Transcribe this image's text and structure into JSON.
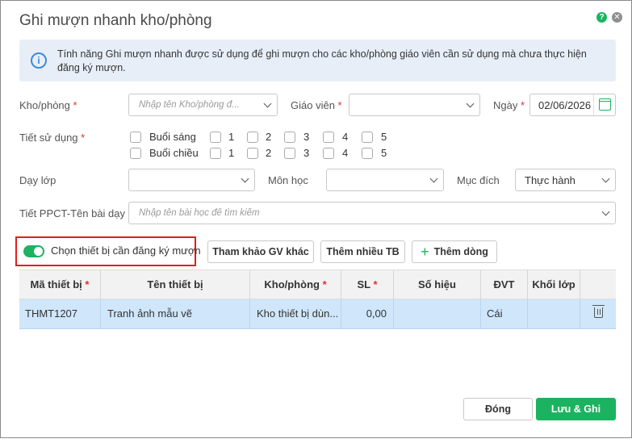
{
  "dialog": {
    "title": "Ghi mượn nhanh kho/phòng",
    "help_icon": "?",
    "close_icon": "✕"
  },
  "info": {
    "icon": "i",
    "text": "Tính năng Ghi mượn nhanh được sử dụng để ghi mượn cho các kho/phòng giáo viên cần sử dụng mà chưa thực hiện đăng ký mượn."
  },
  "form": {
    "kho_phong": {
      "label": "Kho/phòng",
      "placeholder": "Nhập tên Kho/phòng đ..."
    },
    "giao_vien": {
      "label": "Giáo viên",
      "value": ""
    },
    "ngay": {
      "label": "Ngày",
      "value": "02/06/2026"
    },
    "tiet_su_dung": {
      "label": "Tiết sử dụng",
      "sessions": [
        {
          "name": "Buổi sáng",
          "periods": [
            "1",
            "2",
            "3",
            "4",
            "5"
          ]
        },
        {
          "name": "Buổi chiều",
          "periods": [
            "1",
            "2",
            "3",
            "4",
            "5"
          ]
        }
      ]
    },
    "day_lop": {
      "label": "Dạy lớp",
      "value": ""
    },
    "mon_hoc": {
      "label": "Môn học",
      "value": ""
    },
    "muc_dich": {
      "label": "Mục đích",
      "value": "Thực hành"
    },
    "tiet_ppct": {
      "label": "Tiết PPCT-Tên bài dạy",
      "placeholder": "Nhập tên bài học để tìm kiếm"
    },
    "required_mark": "*"
  },
  "toolbar": {
    "toggle_label": "Chọn thiết bị cần đăng ký mượn",
    "toggle_on": true,
    "btn_tham_khao": "Tham khảo GV khác",
    "btn_them_nhieu": "Thêm nhiều TB",
    "btn_them_dong": "Thêm dòng",
    "plus": "+"
  },
  "table": {
    "headers": [
      "Mã thiết bị",
      "Tên thiết bị",
      "Kho/phòng",
      "SL",
      "Số hiệu",
      "ĐVT",
      "Khối lớp"
    ],
    "rows": [
      {
        "ma": "THMT1207",
        "ten": "Tranh ảnh mẫu vẽ",
        "kho": "Kho thiết bị dùn...",
        "sl": "0,00",
        "so_hieu": "",
        "dvt": "Cái",
        "khoi_lop": ""
      }
    ]
  },
  "footer": {
    "close_label": "Đóng",
    "save_label": "Lưu & Ghi mượn"
  },
  "colors": {
    "accent": "#1bb360",
    "highlight": "#e02020",
    "selected_row": "#cfe6fb",
    "info_bg": "#e8eef8"
  }
}
